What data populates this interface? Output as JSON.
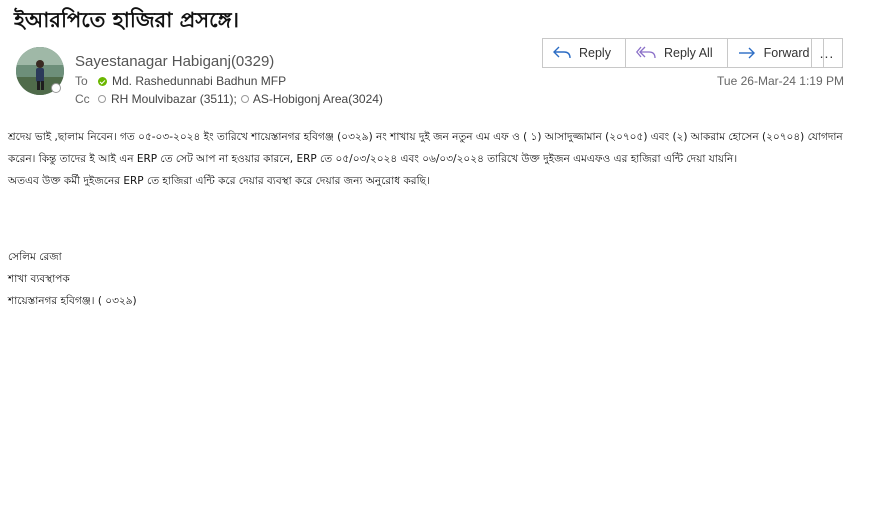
{
  "email": {
    "subject": "ইআরপিতে হাজিরা প্রসঙ্গে।",
    "sender": "Sayestanagar Habiganj(0329)",
    "to_label": "To",
    "cc_label": "Cc",
    "to": [
      {
        "name": "Md. Rashedunnabi Badhun MFP",
        "presence": "available"
      }
    ],
    "cc": [
      {
        "name": "RH Moulvibazar (3511);",
        "presence": "unknown"
      },
      {
        "name": "AS-Hobigonj Area(3024)",
        "presence": "unknown"
      }
    ],
    "timestamp": "Tue 26-Mar-24 1:19 PM",
    "actions": {
      "reply": "Reply",
      "reply_all": "Reply All",
      "forward": "Forward",
      "more": "..."
    },
    "body_lines": [
      "শ্রদেয় ভাই ,ছালাম নিবেন। গত ০৫-০৩-২০২৪  ইং তারিখে শায়েস্তানগর হবিগঞ্জ (০৩২৯) নং শাখায় দুই জন নতুন এম এফ ও ( ১) আসাদুজ্জামান (২০৭০৫) এবং (২) আকরাম হোসেন (২০৭০৪) যোগদান",
      "করেন। কিন্তু তাদের ই আই এন   ERP তে সেট আপ না হওয়ার কারনে, ERP তে  ০৫/০৩/২০২৪ এবং ০৬/০৩/২০২৪ তারিখে  উক্ত দুইজন এমএফও এর হাজিরা এন্টি দেয়া যায়নি।",
      "অতএব উক্ত কর্মী দুইজনের   ERP তে হাজিরা এন্টি করে দেয়ার ব্যবস্থা করে দেয়ার জন্য অনুরোধ করছি।"
    ],
    "signature": [
      "সেলিম রেজা",
      "শাখা ব্যবস্থাপক",
      "শায়েস্তানগর হবিগঞ্জ। ( ০৩২৯)"
    ]
  },
  "colors": {
    "presence_green": "#6bb700",
    "icon_blue": "#2b6cc4",
    "reply_all_purple": "#8a6fc8"
  },
  "icons": {
    "reply": "reply-arrow-icon",
    "reply_all": "reply-all-arrow-icon",
    "forward": "forward-arrow-icon",
    "more": "ellipsis-icon"
  }
}
